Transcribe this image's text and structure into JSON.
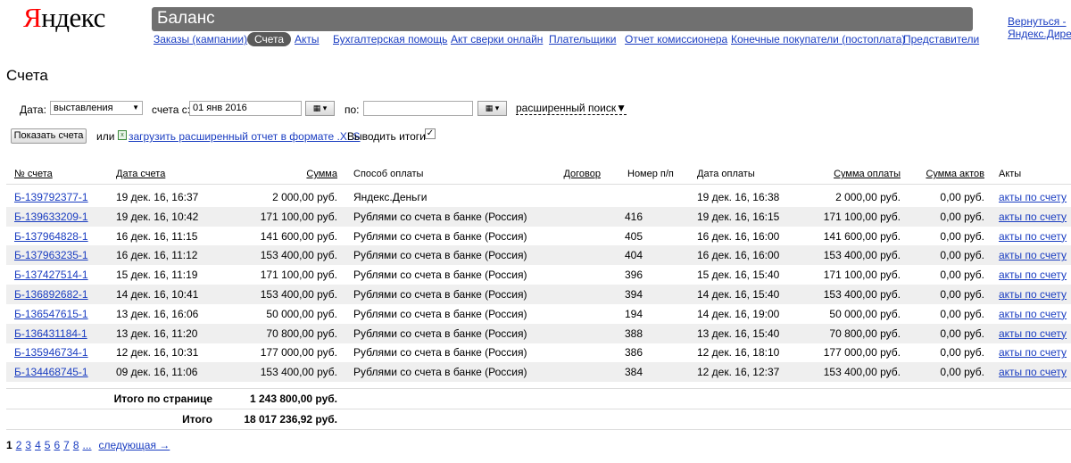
{
  "header": {
    "logo_first": "Я",
    "logo_rest": "ндекс",
    "title": "Баланс",
    "back_link": "Вернуться -\nЯндекс.Директ"
  },
  "nav": [
    {
      "label": "Заказы (кампании)",
      "active": false
    },
    {
      "label": "Счета",
      "active": true
    },
    {
      "label": "Акты",
      "active": false
    },
    {
      "label": "Бухгалтерская помощь",
      "active": false
    },
    {
      "label": "Акт сверки онлайн",
      "active": false
    },
    {
      "label": "Плательщики",
      "active": false
    },
    {
      "label": "Отчет комиссионера",
      "active": false
    },
    {
      "label": "Конечные покупатели (постоплата)",
      "active": false
    },
    {
      "label": "Представители",
      "active": false
    }
  ],
  "page_title": "Счета",
  "filters": {
    "date_label": "Дата:",
    "date_type": "выставления",
    "from_label": "счета с:",
    "from_value": "01 янв 2016",
    "to_label": "по:",
    "to_value": "",
    "advanced_search": "расширенный поиск",
    "advanced_arrow": "▼",
    "show_button": "Показать счета",
    "or_label": "или",
    "xls_link": "загрузить расширенный отчет в формате .XLS",
    "totals_label": "Выводить итоги",
    "totals_checked": true
  },
  "table": {
    "columns": [
      "№ счета",
      "Дата счета",
      "Сумма",
      "Способ оплаты",
      "Договор",
      "Номер п/п",
      "Дата оплаты",
      "Сумма оплаты",
      "Сумма актов",
      "Акты"
    ],
    "rows": [
      {
        "num": "Б-139792377-1",
        "date": "19 дек. 16, 16:37",
        "sum": "2 000,00 руб.",
        "method": "Яндекс.Деньги",
        "contract": "",
        "pp": "",
        "paid_date": "19 дек. 16, 16:38",
        "paid_sum": "2 000,00 руб.",
        "acts_sum": "0,00 руб.",
        "acts": "акты по счету"
      },
      {
        "num": "Б-139633209-1",
        "date": "19 дек. 16, 10:42",
        "sum": "171 100,00 руб.",
        "method": "Рублями со счета в банке (Россия)",
        "contract": "",
        "pp": "416",
        "paid_date": "19 дек. 16, 16:15",
        "paid_sum": "171 100,00 руб.",
        "acts_sum": "0,00 руб.",
        "acts": "акты по счету"
      },
      {
        "num": "Б-137964828-1",
        "date": "16 дек. 16, 11:15",
        "sum": "141 600,00 руб.",
        "method": "Рублями со счета в банке (Россия)",
        "contract": "",
        "pp": "405",
        "paid_date": "16 дек. 16, 16:00",
        "paid_sum": "141 600,00 руб.",
        "acts_sum": "0,00 руб.",
        "acts": "акты по счету"
      },
      {
        "num": "Б-137963235-1",
        "date": "16 дек. 16, 11:12",
        "sum": "153 400,00 руб.",
        "method": "Рублями со счета в банке (Россия)",
        "contract": "",
        "pp": "404",
        "paid_date": "16 дек. 16, 16:00",
        "paid_sum": "153 400,00 руб.",
        "acts_sum": "0,00 руб.",
        "acts": "акты по счету"
      },
      {
        "num": "Б-137427514-1",
        "date": "15 дек. 16, 11:19",
        "sum": "171 100,00 руб.",
        "method": "Рублями со счета в банке (Россия)",
        "contract": "",
        "pp": "396",
        "paid_date": "15 дек. 16, 15:40",
        "paid_sum": "171 100,00 руб.",
        "acts_sum": "0,00 руб.",
        "acts": "акты по счету"
      },
      {
        "num": "Б-136892682-1",
        "date": "14 дек. 16, 10:41",
        "sum": "153 400,00 руб.",
        "method": "Рублями со счета в банке (Россия)",
        "contract": "",
        "pp": "394",
        "paid_date": "14 дек. 16, 15:40",
        "paid_sum": "153 400,00 руб.",
        "acts_sum": "0,00 руб.",
        "acts": "акты по счету"
      },
      {
        "num": "Б-136547615-1",
        "date": "13 дек. 16, 16:06",
        "sum": "50 000,00 руб.",
        "method": "Рублями со счета в банке (Россия)",
        "contract": "",
        "pp": "194",
        "paid_date": "14 дек. 16, 19:00",
        "paid_sum": "50 000,00 руб.",
        "acts_sum": "0,00 руб.",
        "acts": "акты по счету"
      },
      {
        "num": "Б-136431184-1",
        "date": "13 дек. 16, 11:20",
        "sum": "70 800,00 руб.",
        "method": "Рублями со счета в банке (Россия)",
        "contract": "",
        "pp": "388",
        "paid_date": "13 дек. 16, 15:40",
        "paid_sum": "70 800,00 руб.",
        "acts_sum": "0,00 руб.",
        "acts": "акты по счету"
      },
      {
        "num": "Б-135946734-1",
        "date": "12 дек. 16, 10:31",
        "sum": "177 000,00 руб.",
        "method": "Рублями со счета в банке (Россия)",
        "contract": "",
        "pp": "386",
        "paid_date": "12 дек. 16, 18:10",
        "paid_sum": "177 000,00 руб.",
        "acts_sum": "0,00 руб.",
        "acts": "акты по счету"
      },
      {
        "num": "Б-134468745-1",
        "date": "09 дек. 16, 11:06",
        "sum": "153 400,00 руб.",
        "method": "Рублями со счета в банке (Россия)",
        "contract": "",
        "pp": "384",
        "paid_date": "12 дек. 16, 12:37",
        "paid_sum": "153 400,00 руб.",
        "acts_sum": "0,00 руб.",
        "acts": "акты по счету"
      }
    ],
    "page_total_label": "Итого по странице",
    "page_total_value": "1 243 800,00 руб.",
    "total_label": "Итого",
    "total_value": "18 017 236,92 руб."
  },
  "pager": {
    "pages": [
      "1",
      "2",
      "3",
      "4",
      "5",
      "6",
      "7",
      "8",
      "..."
    ],
    "current": "1",
    "next": "следующая →"
  },
  "colors": {
    "link": "#1a3dc1",
    "title_bar": "#707070",
    "active_tab": "#5a5a5a",
    "row_stripe": "#efefef",
    "logo_red": "#ff0000"
  }
}
